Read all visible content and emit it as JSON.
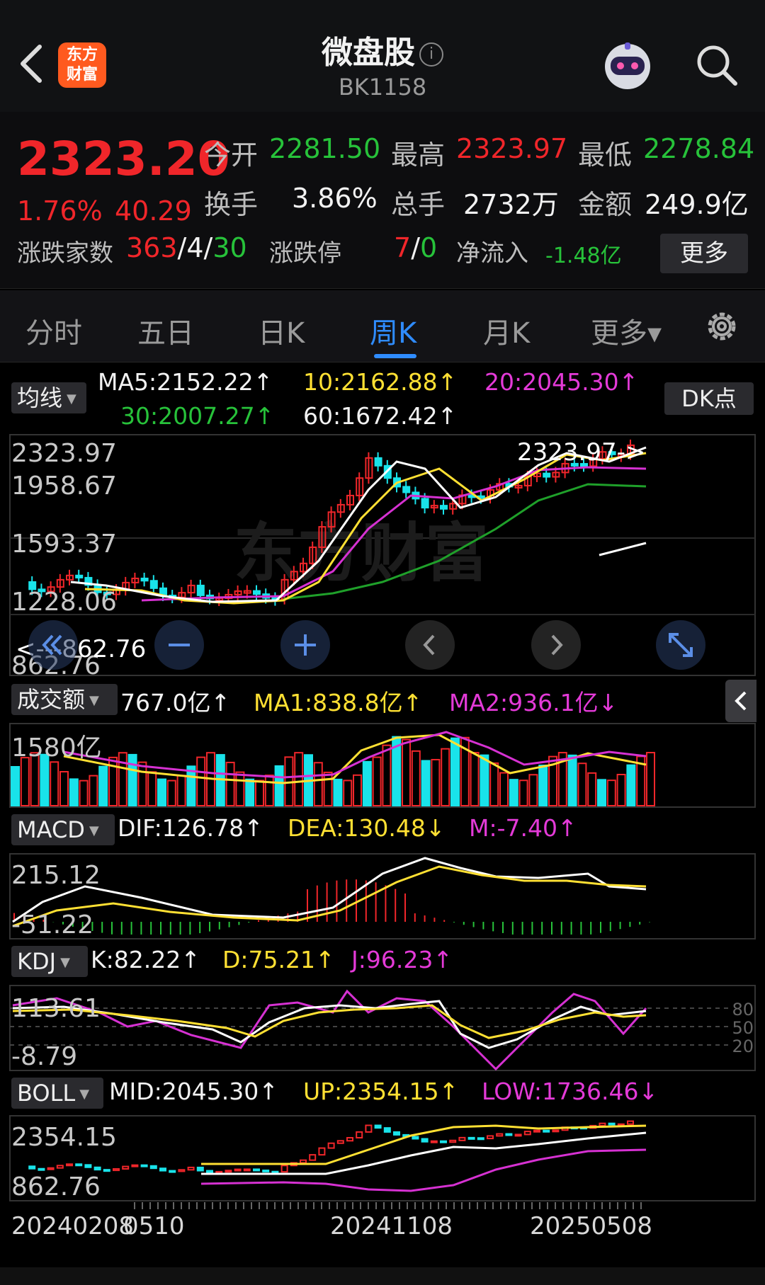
{
  "header": {
    "logo_text_1": "东方",
    "logo_text_2": "财富",
    "title": "微盘股",
    "code": "BK1158"
  },
  "quote": {
    "price": "2323.20",
    "change_pct": "1.76%",
    "change_amt": "40.29",
    "open_label": "今开",
    "open": "2281.50",
    "high_label": "最高",
    "high": "2323.97",
    "low_label": "最低",
    "low": "2278.84",
    "turnover_label": "换手",
    "turnover": "3.86%",
    "volume_label": "总手",
    "volume": "2732万",
    "amount_label": "金额",
    "amount": "249.9亿",
    "breadth_label": "涨跌家数",
    "up_count": "363",
    "flat_count": "4",
    "down_count": "30",
    "limit_label": "涨跌停",
    "limit_up": "7",
    "limit_down": "0",
    "inflow_label": "净流入",
    "inflow": "-1.48亿",
    "more_label": "更多"
  },
  "tabs": [
    {
      "label": "分时"
    },
    {
      "label": "五日"
    },
    {
      "label": "日K"
    },
    {
      "label": "周K"
    },
    {
      "label": "月K"
    },
    {
      "label": "更多▾"
    }
  ],
  "main_chart": {
    "ind_label": "均线",
    "ma5": "MA5:2152.22↑",
    "ma10": "10:2162.88↑",
    "ma20": "20:2045.30↑",
    "ma30": "30:2007.27↑",
    "ma60": "60:1672.42↑",
    "dk_label": "DK点",
    "y_ticks": [
      "2323.97",
      "1958.67",
      "1593.37",
      "1228.06",
      "862.76"
    ],
    "max_marker": "2323.97->",
    "min_marker": "<---862.76"
  },
  "volume_chart": {
    "ind_label": "成交额",
    "value": "767.0亿↑",
    "ma1": "MA1:838.8亿↑",
    "ma2": "MA2:936.1亿↓",
    "y_tick": "1580亿"
  },
  "macd_chart": {
    "ind_label": "MACD",
    "dif": "DIF:126.78↑",
    "dea": "DEA:130.48↓",
    "m": "M:-7.40↑",
    "y_ticks": [
      "215.12",
      "-51.22"
    ]
  },
  "kdj_chart": {
    "ind_label": "KDJ",
    "k": "K:82.22↑",
    "d": "D:75.21↑",
    "j": "J:96.23↑",
    "y_ticks": [
      "113.61",
      "-8.79"
    ],
    "right_ticks": [
      "80",
      "50",
      "20"
    ]
  },
  "boll_chart": {
    "ind_label": "BOLL",
    "mid": "MID:2045.30↑",
    "up": "UP:2354.15↑",
    "low": "LOW:1736.46↓",
    "y_ticks": [
      "2354.15",
      "862.76"
    ]
  },
  "x_dates": [
    "20240208",
    "0510",
    "20241108",
    "20250508"
  ],
  "colors": {
    "up": "#f0262a",
    "down": "#19e3ea",
    "accent": "#2f8cff"
  }
}
